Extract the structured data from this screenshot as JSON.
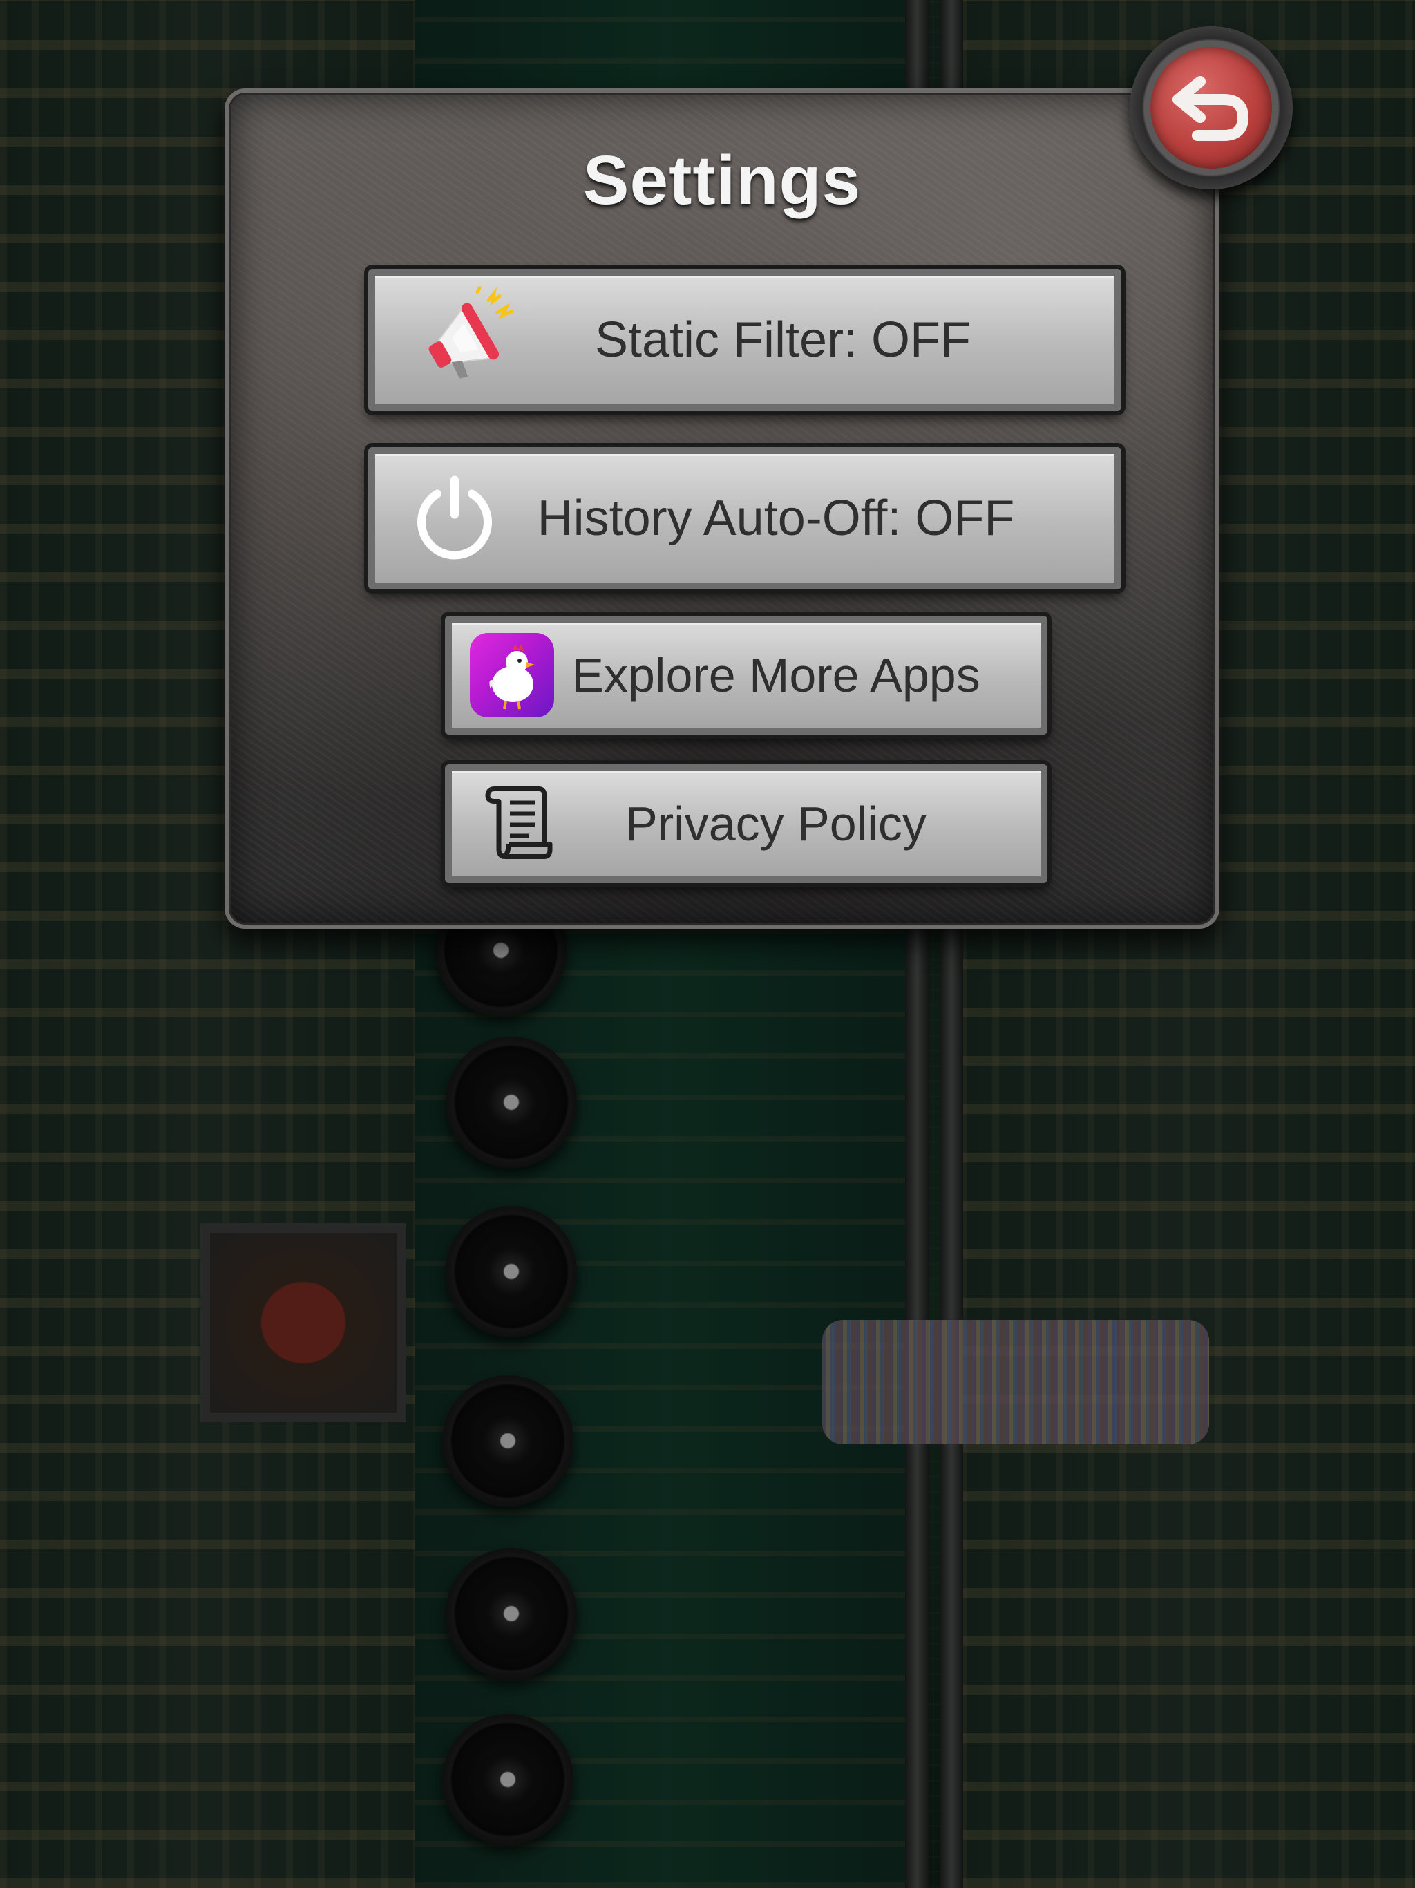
{
  "settings": {
    "title": "Settings",
    "back_icon": "undo-arrow-icon",
    "buttons": {
      "static_filter": {
        "label": "Static Filter: OFF",
        "icon": "megaphone-icon"
      },
      "history_auto_off": {
        "label": "History Auto-Off: OFF",
        "icon": "power-icon"
      },
      "explore_more_apps": {
        "label": "Explore More Apps",
        "icon": "chicken-app-icon"
      },
      "privacy_policy": {
        "label": "Privacy Policy",
        "icon": "scroll-document-icon"
      }
    }
  },
  "colors": {
    "button_text": "#2f2f2f",
    "title_text": "#f4f4f4",
    "back_button_red": "#b9403d",
    "app_tile_purple": "#b21ad1"
  }
}
